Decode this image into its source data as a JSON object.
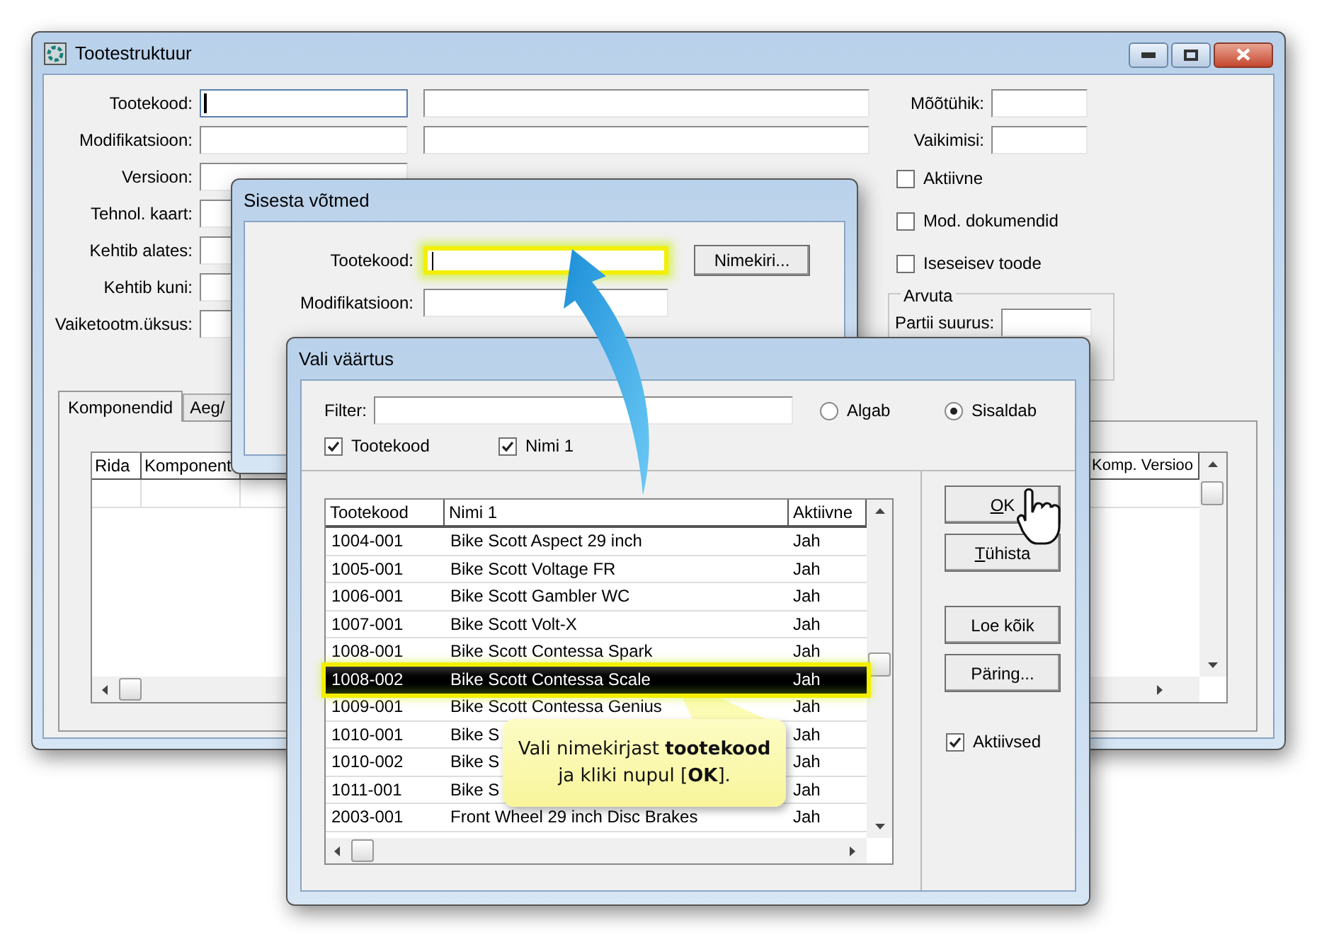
{
  "main_window": {
    "title": "Tootestruktuur",
    "form_rows": [
      {
        "label": "Tootekood:",
        "kind": "double",
        "focused": true
      },
      {
        "label": "Modifikatsioon:",
        "kind": "double",
        "focused": false
      },
      {
        "label": "Versioon:",
        "kind": "single",
        "focused": false
      },
      {
        "label": "Tehnol. kaart:",
        "kind": "single",
        "focused": false
      },
      {
        "label": "Kehtib alates:",
        "kind": "single",
        "focused": false
      },
      {
        "label": "Kehtib kuni:",
        "kind": "single",
        "focused": false
      },
      {
        "label": "Vaiketootm.üksus:",
        "kind": "single",
        "focused": false
      }
    ],
    "right_fields": [
      {
        "label": "Mõõtühik:"
      },
      {
        "label": "Vaikimisi:"
      }
    ],
    "checkboxes": [
      {
        "label": "Aktiivne",
        "checked": false
      },
      {
        "label": "Mod. dokumendid",
        "checked": false
      },
      {
        "label": "Iseseisev toode",
        "checked": false
      }
    ],
    "group": {
      "title": "Arvuta",
      "field_label": "Partii suurus:"
    },
    "tabs": [
      {
        "label": "Komponendid",
        "selected": true
      },
      {
        "label": "Aeg/",
        "selected": false
      }
    ],
    "table": {
      "columns": [
        "Rida",
        "Komponent",
        "Komp. Versioo"
      ]
    }
  },
  "key_dialog": {
    "title": "Sisesta võtmed",
    "button": "Nimekiri...",
    "fields": [
      {
        "label": "Tootekood:",
        "highlighted": true,
        "focused": true
      },
      {
        "label": "Modifikatsioon:",
        "highlighted": false,
        "focused": false
      }
    ]
  },
  "pick_dialog": {
    "title": "Vali väärtus",
    "filter_label": "Filter:",
    "match_options": [
      {
        "label": "Algab",
        "selected": false
      },
      {
        "label": "Sisaldab",
        "selected": true
      }
    ],
    "search_in": [
      {
        "label": "Tootekood",
        "checked": true
      },
      {
        "label": "Nimi 1",
        "checked": true
      }
    ],
    "columns": [
      "Tootekood",
      "Nimi 1",
      "Aktiivne"
    ],
    "rows": [
      {
        "code": "1004-001",
        "name": "Bike Scott Aspect 29 inch",
        "active": "Jah",
        "selected": false
      },
      {
        "code": "1005-001",
        "name": "Bike Scott Voltage FR",
        "active": "Jah",
        "selected": false
      },
      {
        "code": "1006-001",
        "name": "Bike Scott Gambler WC",
        "active": "Jah",
        "selected": false
      },
      {
        "code": "1007-001",
        "name": "Bike Scott Volt-X",
        "active": "Jah",
        "selected": false
      },
      {
        "code": "1008-001",
        "name": "Bike Scott Contessa Spark",
        "active": "Jah",
        "selected": false
      },
      {
        "code": "1008-002",
        "name": "Bike Scott Contessa Scale",
        "active": "Jah",
        "selected": true
      },
      {
        "code": "1009-001",
        "name": "Bike Scott Contessa Genius",
        "active": "Jah",
        "selected": false
      },
      {
        "code": "1010-001",
        "name": "Bike S",
        "active": "Jah",
        "selected": false
      },
      {
        "code": "1010-002",
        "name": "Bike S",
        "active": "Jah",
        "selected": false
      },
      {
        "code": "1011-001",
        "name": "Bike S",
        "active": "Jah",
        "selected": false
      },
      {
        "code": "2003-001",
        "name": "Front Wheel 29 inch Disc Brakes",
        "active": "Jah",
        "selected": false
      }
    ],
    "buttons": [
      {
        "label": "OK",
        "accel": true
      },
      {
        "label": "Tühista",
        "accel": true
      },
      {
        "label": "Loe kõik",
        "accel": false
      },
      {
        "label": "Päring...",
        "accel": false
      }
    ],
    "active_only": {
      "label": "Aktiivsed",
      "checked": true
    }
  },
  "callout": {
    "text": "Vali nimekirjast **tootekood** ja kliki nupul [**OK**]."
  }
}
